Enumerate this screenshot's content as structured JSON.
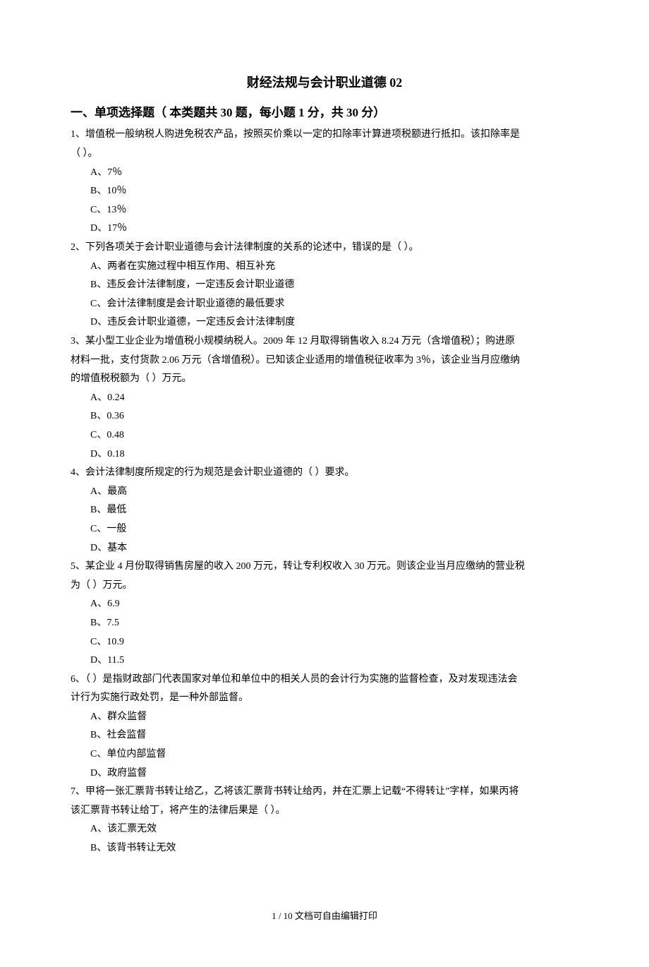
{
  "title": "财经法规与会计职业道德 02",
  "section1": "一、单项选择题（ 本类题共 30 题，每小题 1 分，共 30 分）",
  "q1": {
    "stem1": "1、增值税一般纳税人购进免税农产品，按照买价乘以一定的扣除率计算进项税额进行抵扣。该扣除率是",
    "stem2": "（  ）。",
    "a": "A、7％",
    "b": "B、10％",
    "c": "C、13％",
    "d": "D、17％"
  },
  "q2": {
    "stem": "2、下列各项关于会计职业道德与会计法律制度的关系的论述中，错误的是（  ）。",
    "a": "A、两者在实施过程中相互作用、相互补充",
    "b": "B、违反会计法律制度，一定违反会计职业道德",
    "c": "C、会计法律制度是会计职业道德的最低要求",
    "d": "D、违反会计职业道德，一定违反会计法律制度"
  },
  "q3": {
    "stem1": "3、某小型工业企业为增值税小规模纳税人。2009 年 12 月取得销售收入 8.24 万元（含增值税）；购进原",
    "stem2": "材料一批，支付货款 2.06 万元（含增值税）。已知该企业适用的增值税征收率为 3％，该企业当月应缴纳",
    "stem3": "的增值税税额为（  ）万元。",
    "a": "A、0.24",
    "b": "B、0.36",
    "c": "C、0.48",
    "d": "D、0.18"
  },
  "q4": {
    "stem": "4、会计法律制度所规定的行为规范是会计职业道德的（  ）要求。",
    "a": "A、最高",
    "b": "B、最低",
    "c": "C、一般",
    "d": "D、基本"
  },
  "q5": {
    "stem1": "5、某企业 4 月份取得销售房屋的收入 200 万元，转让专利权收入 30 万元。则该企业当月应缴纳的营业税",
    "stem2": "为（  ）万元。",
    "a": "A、6.9",
    "b": "B、7.5",
    "c": "C、10.9",
    "d": "D、11.5"
  },
  "q6": {
    "stem1": "6、（  ）是指财政部门代表国家对单位和单位中的相关人员的会计行为实施的监督检查，及对发现违法会",
    "stem2": "计行为实施行政处罚，是一种外部监督。",
    "a": "A、群众监督",
    "b": "B、社会监督",
    "c": "C、单位内部监督",
    "d": "D、政府监督"
  },
  "q7": {
    "stem1": "7、甲将一张汇票背书转让给乙，乙将该汇票背书转让给丙，并在汇票上记载“不得转让”字样，如果丙将",
    "stem2": "该汇票背书转让给丁，将产生的法律后果是（  ）。",
    "a": "A、该汇票无效",
    "b": "B、该背书转让无效"
  },
  "footer": "1 / 10 文档可自由编辑打印"
}
